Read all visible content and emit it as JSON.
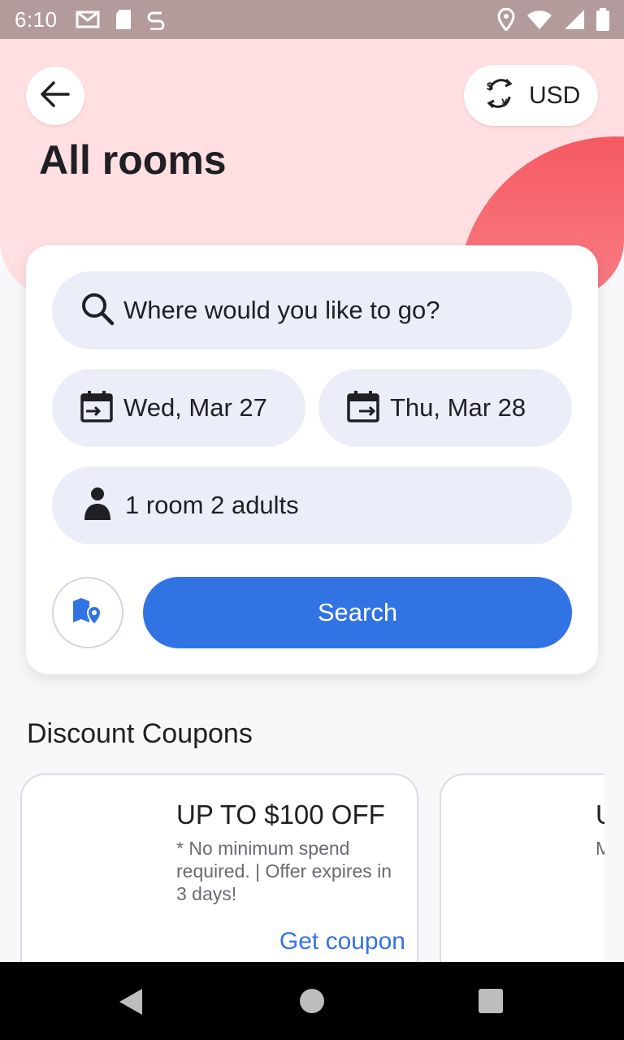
{
  "status_bar": {
    "time": "6:10",
    "left_icons": [
      "gmail-icon",
      "sd-card-icon",
      "sync-icon"
    ],
    "right_icons": [
      "location-icon",
      "wifi-icon",
      "signal-icon",
      "battery-icon"
    ]
  },
  "header": {
    "title": "All rooms",
    "currency": "USD",
    "back_icon": "arrow-left-icon",
    "currency_icon": "currency-exchange-icon"
  },
  "search": {
    "destination_placeholder": "Where would you like to go?",
    "checkin": "Wed, Mar 27",
    "checkout": "Thu, Mar 28",
    "guests": "1 room 2 adults",
    "search_label": "Search",
    "map_icon": "map-pin-icon"
  },
  "coupons": {
    "section_title": "Discount Coupons",
    "items": [
      {
        "title": "UP TO $100 OFF",
        "description": "* No minimum spend required.  | Offer expires in 3 days!",
        "cta": "Get coupon"
      },
      {
        "title": "U",
        "description": "M e",
        "cta": ""
      }
    ]
  },
  "colors": {
    "status_bar": "#b39b9b",
    "header_bg": "#ffdfe1",
    "accent_circle": "#f65a62",
    "primary": "#3273e3",
    "field_bg": "#ebeef8"
  }
}
